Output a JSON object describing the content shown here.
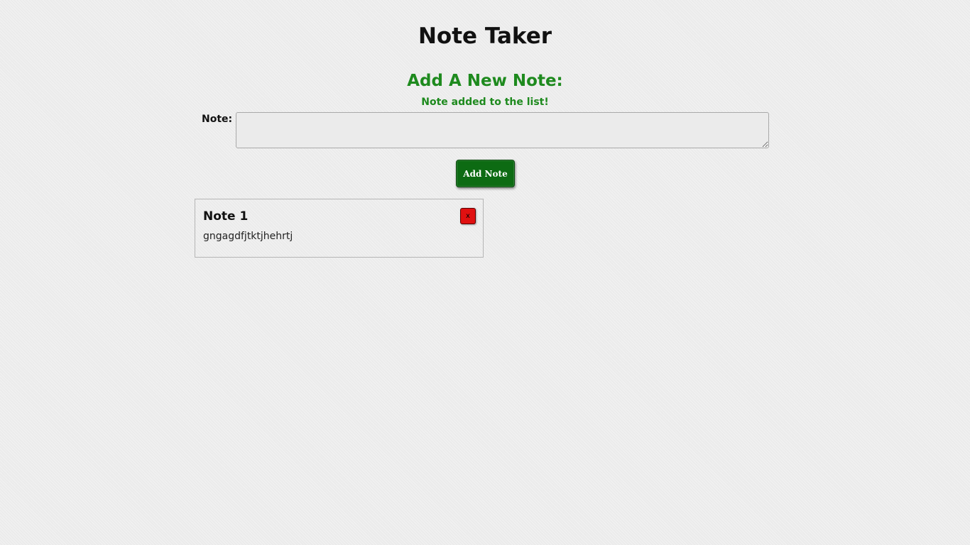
{
  "app": {
    "title": "Note Taker"
  },
  "form": {
    "heading": "Add A New Note:",
    "status_message": "Note added to the list!",
    "note_label": "Note:",
    "note_value": "",
    "note_placeholder": "",
    "add_button_label": "Add Note"
  },
  "notes": [
    {
      "title": "Note 1",
      "body": "gngagdfjtktjhehrtj",
      "delete_label": "x"
    }
  ],
  "colors": {
    "heading_green": "#1e8a1e",
    "button_green": "#0d6b13",
    "delete_red": "#e01010",
    "background": "#ebebeb"
  }
}
